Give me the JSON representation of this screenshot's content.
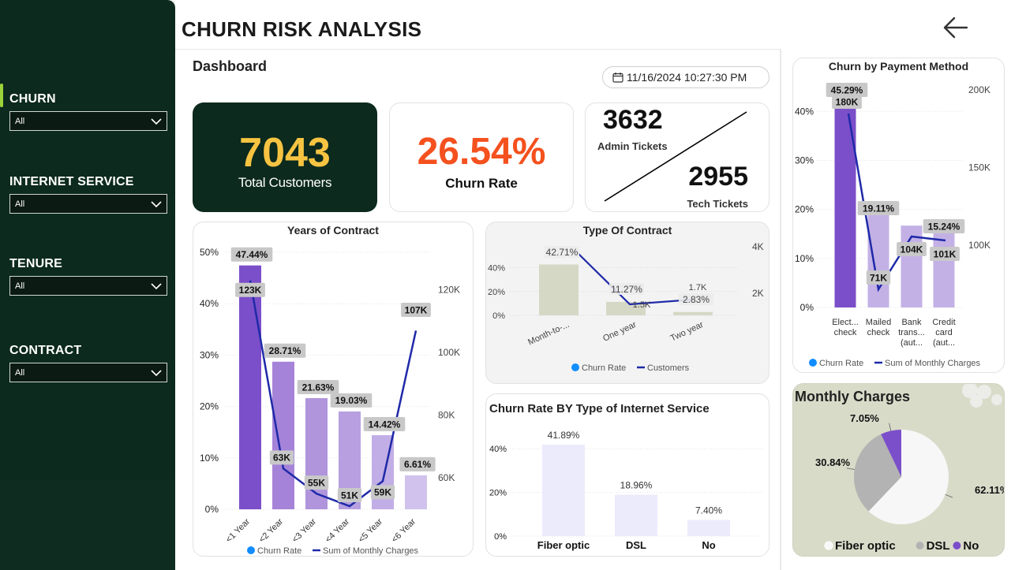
{
  "colors": {
    "sidebar": "#0c2a1d",
    "accent_green": "#9ad43a",
    "kpi_yellow": "#f7c442",
    "kpi_orange": "#f4511e",
    "bar_dark_purple": "#7b4fc9",
    "line_navy": "#1f2aa8",
    "label_gray": "#c8c8c8",
    "legend_blue": "#118dff"
  },
  "header": {
    "title": "CHURN RISK ANALYSIS",
    "subtitle": "Dashboard",
    "datetime": "11/16/2024 10:27:30 PM"
  },
  "filters": [
    {
      "label": "CHURN",
      "value": "All"
    },
    {
      "label": "INTERNET SERVICE",
      "value": "All"
    },
    {
      "label": "TENURE",
      "value": "All"
    },
    {
      "label": "CONTRACT",
      "value": "All"
    }
  ],
  "kpis": {
    "total_customers": {
      "value": "7043",
      "label": "Total Customers"
    },
    "churn_rate": {
      "value": "26.54%",
      "label": "Churn Rate"
    },
    "admin_tickets": {
      "value": "3632",
      "label": "Admin Tickets"
    },
    "tech_tickets": {
      "value": "2955",
      "label": "Tech Tickets"
    }
  },
  "chart_data": [
    {
      "id": "years_of_contract",
      "type": "bar",
      "title": "Years of Contract",
      "categories": [
        "<1 Year",
        "<2 Year",
        "<3 Year",
        "<4 Year",
        "<5 Year",
        "<6 Year"
      ],
      "y_ticks": [
        "0%",
        "10%",
        "20%",
        "30%",
        "40%",
        "50%"
      ],
      "y2_ticks": [
        "60K",
        "80K",
        "100K",
        "120K"
      ],
      "ylim": [
        0,
        50
      ],
      "y2lim": [
        50000,
        132000
      ],
      "series": [
        {
          "name": "Churn Rate",
          "kind": "bar",
          "values": [
            47.44,
            28.71,
            21.63,
            19.03,
            14.42,
            6.61
          ],
          "labels": [
            "47.44%",
            "28.71%",
            "21.63%",
            "19.03%",
            "14.42%",
            "6.61%"
          ],
          "colors": [
            "#7b4fc9",
            "#a583d9",
            "#b095dd",
            "#b79fe0",
            "#c2aee6",
            "#d0c2ec"
          ]
        },
        {
          "name": "Sum of Monthly Charges",
          "kind": "line",
          "values": [
            123000,
            63000,
            55000,
            51000,
            59000,
            107000
          ],
          "labels": [
            "123K",
            "63K",
            "55K",
            "51K",
            "59K",
            "107K"
          ]
        }
      ]
    },
    {
      "id": "type_of_contract",
      "type": "bar",
      "title": "Type Of Contract",
      "categories": [
        "Month-to-...",
        "One year",
        "Two year"
      ],
      "y_ticks": [
        "0%",
        "20%",
        "40%"
      ],
      "y2_ticks": [
        "2K",
        "4K"
      ],
      "ylim": [
        0,
        45
      ],
      "y2lim": [
        0,
        4400
      ],
      "series": [
        {
          "name": "Churn Rate",
          "kind": "bar",
          "values": [
            42.71,
            11.27,
            2.83
          ],
          "labels": [
            "42.71%",
            "11.27%",
            "2.83%"
          ]
        },
        {
          "name": "Customers",
          "kind": "line",
          "values": [
            3900,
            1500,
            1700
          ],
          "labels": [
            "",
            "1.5K",
            "1.7K"
          ]
        }
      ]
    },
    {
      "id": "internet_service",
      "type": "bar",
      "title": "Churn Rate BY Type of Internet Service",
      "categories": [
        "Fiber optic",
        "DSL",
        "No"
      ],
      "y_ticks": [
        "0%",
        "20%",
        "40%"
      ],
      "ylim": [
        0,
        44
      ],
      "series": [
        {
          "name": "Churn Rate",
          "kind": "bar",
          "values": [
            41.89,
            18.96,
            7.4
          ],
          "labels": [
            "41.89%",
            "18.96%",
            "7.40%"
          ]
        }
      ]
    },
    {
      "id": "payment_method",
      "type": "bar",
      "title": "Churn by Payment Method",
      "categories": [
        "Elect... check",
        "Mailed check",
        "Bank trans... (aut...",
        "Credit card (aut..."
      ],
      "y_ticks": [
        "0%",
        "10%",
        "20%",
        "30%",
        "40%"
      ],
      "y2_ticks": [
        "100K",
        "150K",
        "200K"
      ],
      "ylim": [
        0,
        46
      ],
      "y2lim": [
        60000,
        205000
      ],
      "series": [
        {
          "name": "Churn Rate",
          "kind": "bar",
          "values": [
            45.29,
            19.11,
            16.7,
            15.24
          ],
          "labels": [
            "45.29%",
            "19.11%",
            "",
            "15.24%"
          ],
          "colors": [
            "#7b4fc9",
            "#c3b1e6",
            "#c3b1e6",
            "#c3b1e6"
          ]
        },
        {
          "name": "Sum of Monthly Charges",
          "kind": "line",
          "values": [
            180000,
            71000,
            104000,
            101000
          ],
          "labels": [
            "180K",
            "71K",
            "104K",
            "101K"
          ]
        }
      ]
    },
    {
      "id": "monthly_charges",
      "type": "pie",
      "title": "Monthly Charges",
      "categories": [
        "Fiber optic",
        "DSL",
        "No"
      ],
      "values": [
        62.11,
        30.84,
        7.05
      ],
      "labels": [
        "62.11%",
        "30.84%",
        "7.05%"
      ],
      "colors": [
        "#f7f7f7",
        "#b3b3b3",
        "#7b4fc9"
      ],
      "legend": "bottom"
    }
  ]
}
